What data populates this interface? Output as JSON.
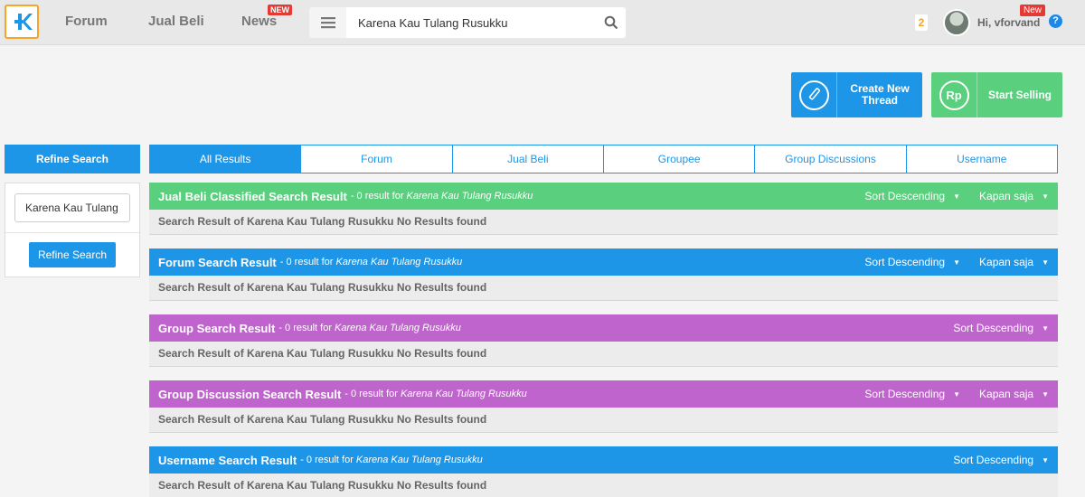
{
  "nav": {
    "items": [
      "Forum",
      "Jual Beli",
      "News"
    ],
    "news_badge": "NEW",
    "search_value": "Karena Kau Tulang Rusukku",
    "notif_count": "2",
    "user_greeting": "Hi, vforvand",
    "user_badge": "New",
    "help": "?"
  },
  "actions": {
    "create_thread": "Create New Thread",
    "start_selling": "Start Selling",
    "rp_icon": "Rp"
  },
  "refine": {
    "title": "Refine Search",
    "input_value": "Karena Kau Tulang Rusukku",
    "button": "Refine Search"
  },
  "tabs": [
    "All Results",
    "Forum",
    "Jual Beli",
    "Groupee",
    "Group Discussions",
    "Username"
  ],
  "sections": [
    {
      "title": "Jual Beli Classified Search Result",
      "count": "- 0 result for",
      "query": "Karena Kau Tulang Rusukku",
      "sort": "Sort Descending",
      "time": "Kapan saja",
      "body": "Search Result of Karena Kau Tulang Rusukku No Results found"
    },
    {
      "title": "Forum Search Result",
      "count": "- 0 result for",
      "query": "Karena Kau Tulang Rusukku",
      "sort": "Sort Descending",
      "time": "Kapan saja",
      "body": "Search Result of Karena Kau Tulang Rusukku No Results found"
    },
    {
      "title": "Group Search Result",
      "count": "- 0 result for",
      "query": "Karena Kau Tulang Rusukku",
      "sort": "Sort Descending",
      "body": "Search Result of Karena Kau Tulang Rusukku No Results found"
    },
    {
      "title": "Group Discussion Search Result",
      "count": "- 0 result for",
      "query": "Karena Kau Tulang Rusukku",
      "sort": "Sort Descending",
      "time": "Kapan saja",
      "body": "Search Result of Karena Kau Tulang Rusukku No Results found"
    },
    {
      "title": "Username Search Result",
      "count": "- 0 result for",
      "query": "Karena Kau Tulang Rusukku",
      "sort": "Sort Descending",
      "body": "Search Result of Karena Kau Tulang Rusukku No Results found"
    }
  ],
  "colors": {
    "blue": "#1e96e8",
    "green": "#5acf7e",
    "purple": "#c064cd",
    "logo_border": "#f5a623",
    "badge_red": "#e53935"
  }
}
